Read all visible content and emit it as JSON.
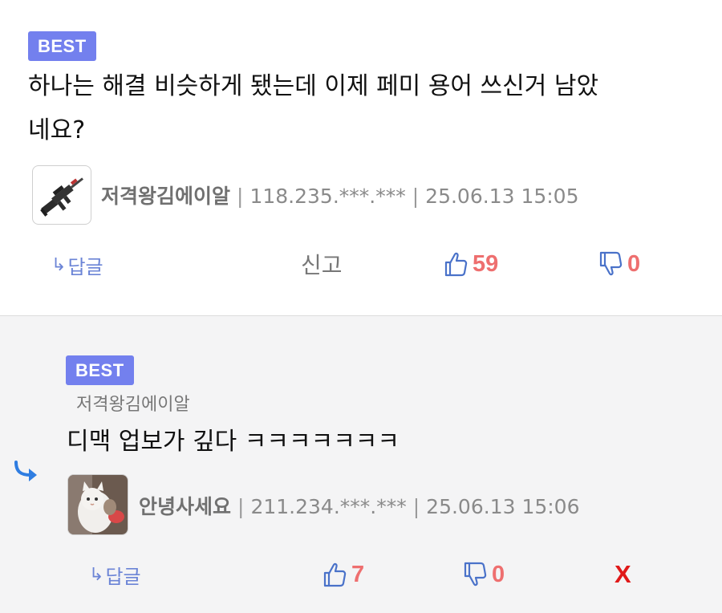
{
  "colors": {
    "badge": "#7380ee",
    "vote_count": "#ee6f6f",
    "thumb_icon": "#4a72c9",
    "reply_link": "#6b84d6",
    "delete": "#e01919",
    "reply_bg": "#f4f4f5"
  },
  "comments": [
    {
      "badge": "BEST",
      "body_line1": "하나는 해결 비슷하게 됐는데 이제 페미 용어 쓰신거 남았",
      "body_line2": "네요?",
      "avatar_icon": "rifle-icon",
      "nickname": "저격왕김에이알",
      "ip": "118.235.***.***",
      "datetime": "25.06.13 15:05",
      "separator": "|",
      "reply_label": "답글",
      "report_label": "신고",
      "likes": "59",
      "dislikes": "0"
    },
    {
      "badge": "BEST",
      "parent_nickname": "저격왕김에이알",
      "body": "디맥 업보가 깊다 ㅋㅋㅋㅋㅋㅋㅋ",
      "avatar_icon": "cat-photo-icon",
      "nickname": "안녕사세요",
      "ip": "211.234.***.***",
      "datetime": "25.06.13 15:06",
      "separator": "|",
      "reply_label": "답글",
      "likes": "7",
      "dislikes": "0",
      "delete_label": "X"
    }
  ]
}
